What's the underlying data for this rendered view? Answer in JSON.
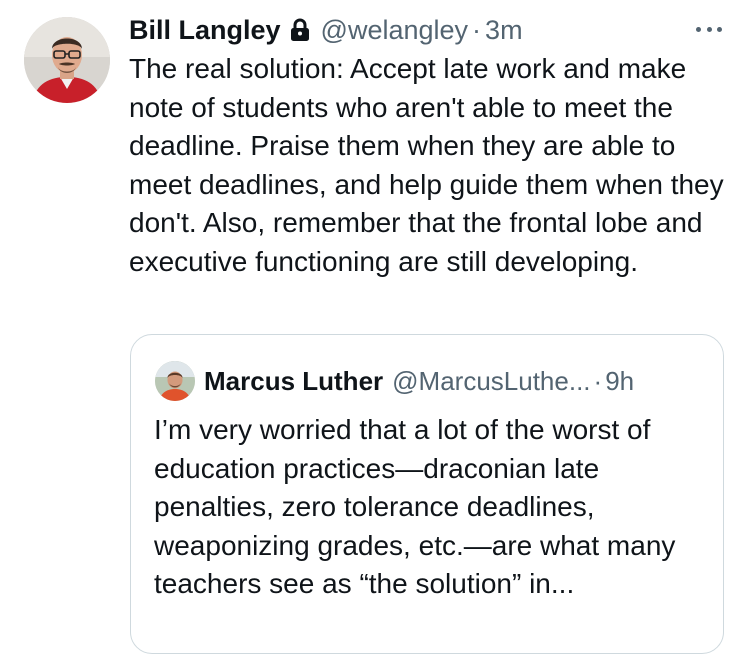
{
  "tweet": {
    "author_name": "Bill Langley",
    "handle": "@welangley",
    "separator": "·",
    "time": "3m",
    "avatar_icon": "user-avatar",
    "lock_icon": "lock-icon",
    "more_icon": "more-options-icon",
    "text": "The real solution: Accept late work and make note of students who aren't able to meet the deadline. Praise them when they are able to meet deadlines, and help guide them when they don't. Also, remember that the frontal lobe and executive functioning are still developing."
  },
  "quoted_tweet": {
    "author_name": "Marcus Luther",
    "handle": "@MarcusLuthe...",
    "separator": "·",
    "time": "9h",
    "avatar_icon": "user-avatar",
    "text": "I’m very worried that a lot of the worst of education practices—draconian late penalties, zero tolerance deadlines, weaponizing grades, etc.—are what many teachers see as “the solution” in..."
  },
  "colors": {
    "text_primary": "#0f1419",
    "text_secondary": "#536471",
    "border": "#cfd9de",
    "background": "#ffffff"
  }
}
